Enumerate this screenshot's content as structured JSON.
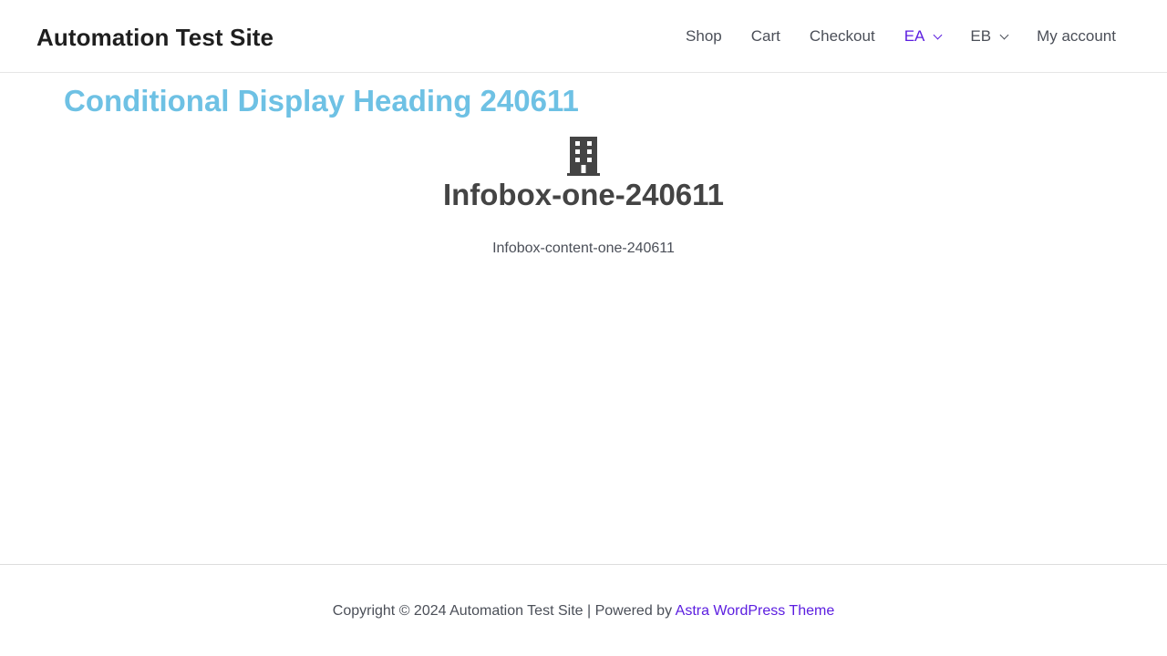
{
  "header": {
    "site_title": "Automation Test Site",
    "nav": [
      {
        "label": "Shop"
      },
      {
        "label": "Cart"
      },
      {
        "label": "Checkout"
      },
      {
        "label": "EA"
      },
      {
        "label": "EB"
      },
      {
        "label": "My account"
      }
    ]
  },
  "main": {
    "conditional_heading": "Conditional Display Heading 240611",
    "infobox": {
      "icon": "building-icon",
      "title": "Infobox-one-240611",
      "content": "Infobox-content-one-240611"
    }
  },
  "footer": {
    "copyright": "Copyright © 2024 Automation Test Site | Powered by ",
    "theme_link": "Astra WordPress Theme"
  },
  "colors": {
    "accent": "#5c1ee0",
    "heading_blue": "#6ec1e4",
    "text": "#4b4f58",
    "title_dark": "#1f1f1f"
  }
}
